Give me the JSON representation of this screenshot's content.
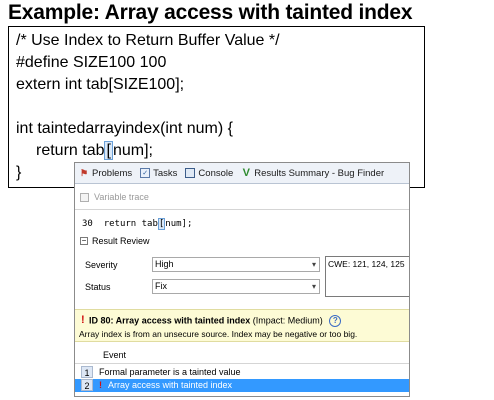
{
  "slide": {
    "title": "Example: Array access with tainted index"
  },
  "code": {
    "line1": "/* Use Index to Return Buffer Value */",
    "line2": "#define SIZE100 100",
    "line3": "extern int tab[SIZE100];",
    "line4": "int taintedarrayindex(int num) {",
    "line5_a": "return tab",
    "line5_b": "[",
    "line5_c": "num];",
    "line6": "}"
  },
  "panel": {
    "tabs": [
      {
        "label": "Problems",
        "icon": "problems-icon"
      },
      {
        "label": "Tasks",
        "icon": "tasks-icon"
      },
      {
        "label": "Console",
        "icon": "console-icon"
      },
      {
        "label": "Results Summary - Bug Finder",
        "icon": "results-summary-icon"
      }
    ],
    "variable_trace_label": "Variable trace",
    "code_ref": {
      "line_no": "30",
      "text_a": "return tab",
      "text_b": "[",
      "text_c": "num];"
    },
    "result_review_label": "Result Review",
    "severity_label": "Severity",
    "severity_value": "High",
    "status_label": "Status",
    "status_value": "Fix",
    "cwe_text": "CWE: 121, 124, 125",
    "id_title_bold": "ID 80: Array access with tainted index",
    "id_title_impact": "(Impact: Medium)",
    "id_desc": "Array index is from an unsecure source. Index may be negative or too big.",
    "event_header": "Event",
    "events": [
      {
        "num": "1",
        "text": "Formal parameter is a tainted value",
        "selected": false
      },
      {
        "num": "2",
        "text": "Array access with tainted index",
        "selected": true
      }
    ]
  },
  "colors": {
    "selection": "#3399ff",
    "warning": "#d01010",
    "squiggle": "#e02020",
    "info_bar": "#fdfbd5"
  }
}
